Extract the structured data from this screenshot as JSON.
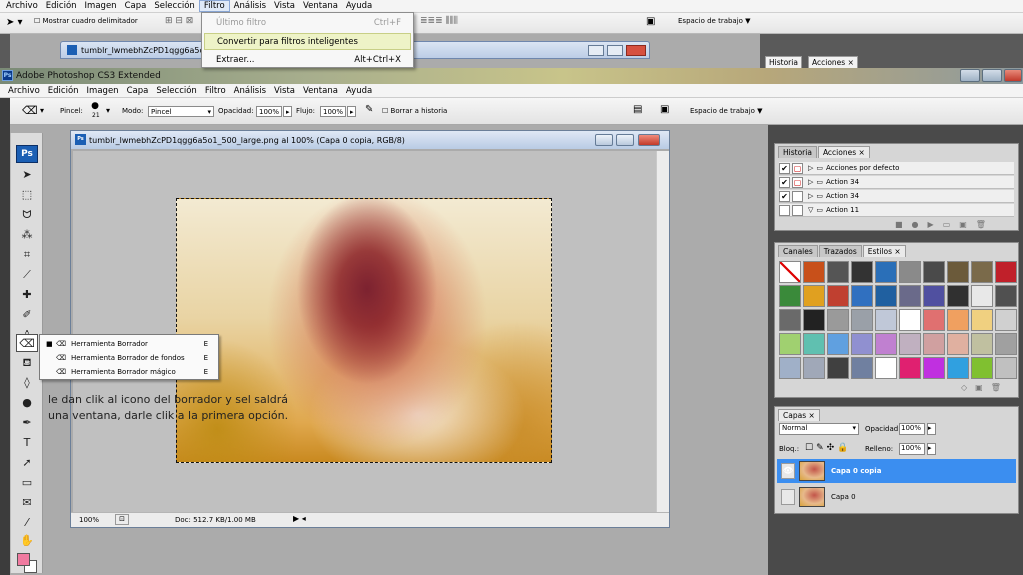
{
  "bg_window": {
    "menu": [
      "Archivo",
      "Edición",
      "Imagen",
      "Capa",
      "Selección",
      "Filtro",
      "Análisis",
      "Vista",
      "Ventana",
      "Ayuda"
    ],
    "active_menu": "Filtro",
    "options_checkbox": "Mostrar cuadro delimitador",
    "workspace": "Espacio de trabajo ▼",
    "doc_title": "tumblr_lwmebhZcPD1qgg6a5c",
    "tabs": [
      "Historia",
      "Acciones ×"
    ]
  },
  "filtro_menu": [
    {
      "label": "Último filtro",
      "shortcut": "Ctrl+F",
      "disabled": true
    },
    {
      "label": "Convertir para filtros inteligentes",
      "shortcut": ""
    },
    {
      "label": "Extraer...",
      "shortcut": "Alt+Ctrl+X"
    }
  ],
  "main_window": {
    "title": "Adobe Photoshop CS3 Extended",
    "menu": [
      "Archivo",
      "Edición",
      "Imagen",
      "Capa",
      "Selección",
      "Filtro",
      "Análisis",
      "Vista",
      "Ventana",
      "Ayuda"
    ]
  },
  "options_bar": {
    "pincel_label": "Pincel:",
    "brush_size": "21",
    "modo_label": "Modo:",
    "modo_value": "Pincel",
    "opacidad_label": "Opacidad:",
    "opacidad_value": "100%",
    "flujo_label": "Flujo:",
    "flujo_value": "100%",
    "borrar_historia": "Borrar a historia",
    "workspace": "Espacio de trabajo ▼"
  },
  "toolbox": {
    "logo": "Ps",
    "fg_color": "#f07aa0",
    "bg_color": "#ffffff"
  },
  "eraser_flyout": [
    {
      "label": "Herramienta Borrador",
      "key": "E",
      "active": true
    },
    {
      "label": "Herramienta Borrador de fondos",
      "key": "E"
    },
    {
      "label": "Herramienta Borrador mágico",
      "key": "E"
    }
  ],
  "document": {
    "title": "tumblr_lwmebhZcPD1qgg6a5o1_500_large.png al 100% (Capa 0 copia, RGB/8)",
    "zoom": "100%",
    "doc_size": "Doc: 512.7 KB/1.00 MB"
  },
  "instruction_line1": "le dan clik al icono del borrador y sel saldrá",
  "instruction_line2": "una ventana, darle clik a la primera opción.",
  "history_panel": {
    "tabs": [
      "Historia",
      "Acciones ×"
    ],
    "rows": [
      "Acciones por defecto",
      "Action 34",
      "Action 34",
      "Action 11"
    ]
  },
  "styles_panel": {
    "tabs": [
      "Canales",
      "Trazados",
      "Estilos ×"
    ],
    "swatches": [
      "#ffffff",
      "#c8501a",
      "#555555",
      "#333333",
      "#2a6fb8",
      "#8a8a8a",
      "#4a4a4a",
      "#6b5a3a",
      "#7a6a4a",
      "#c0202a",
      "#3a8a3a",
      "#e0a020",
      "#c04030",
      "#3070c0",
      "#2060a0",
      "#6a6a8a",
      "#5050a0",
      "#303030",
      "#e8e8e8",
      "#505050",
      "#6a6a6a",
      "#222222",
      "#9a9a9a",
      "#9aa0a8",
      "#c0c8d8",
      "#ffffff",
      "#e07070",
      "#f0a060",
      "#f0d080",
      "#d0d0d0",
      "#a0d070",
      "#60c0b0",
      "#60a0e0",
      "#9090d0",
      "#c080d0",
      "#c0b0c0",
      "#d0a0a0",
      "#e0b0a0",
      "#c0c0a0",
      "#a0a0a0",
      "#a0b0c8",
      "#a0a8b8",
      "#404040",
      "#7080a0",
      "#ffffff",
      "#e02070",
      "#c030e0",
      "#30a0e0",
      "#80c030",
      "#c0c0c0"
    ]
  },
  "layers_panel": {
    "tab": "Capas ×",
    "blend": "Normal",
    "opacidad_label": "Opacidad:",
    "opacidad_value": "100%",
    "bloq_label": "Bloq.:",
    "relleno_label": "Relleno:",
    "relleno_value": "100%",
    "layers": [
      {
        "name": "Capa 0 copia",
        "selected": true
      },
      {
        "name": "Capa 0",
        "selected": false
      }
    ]
  }
}
